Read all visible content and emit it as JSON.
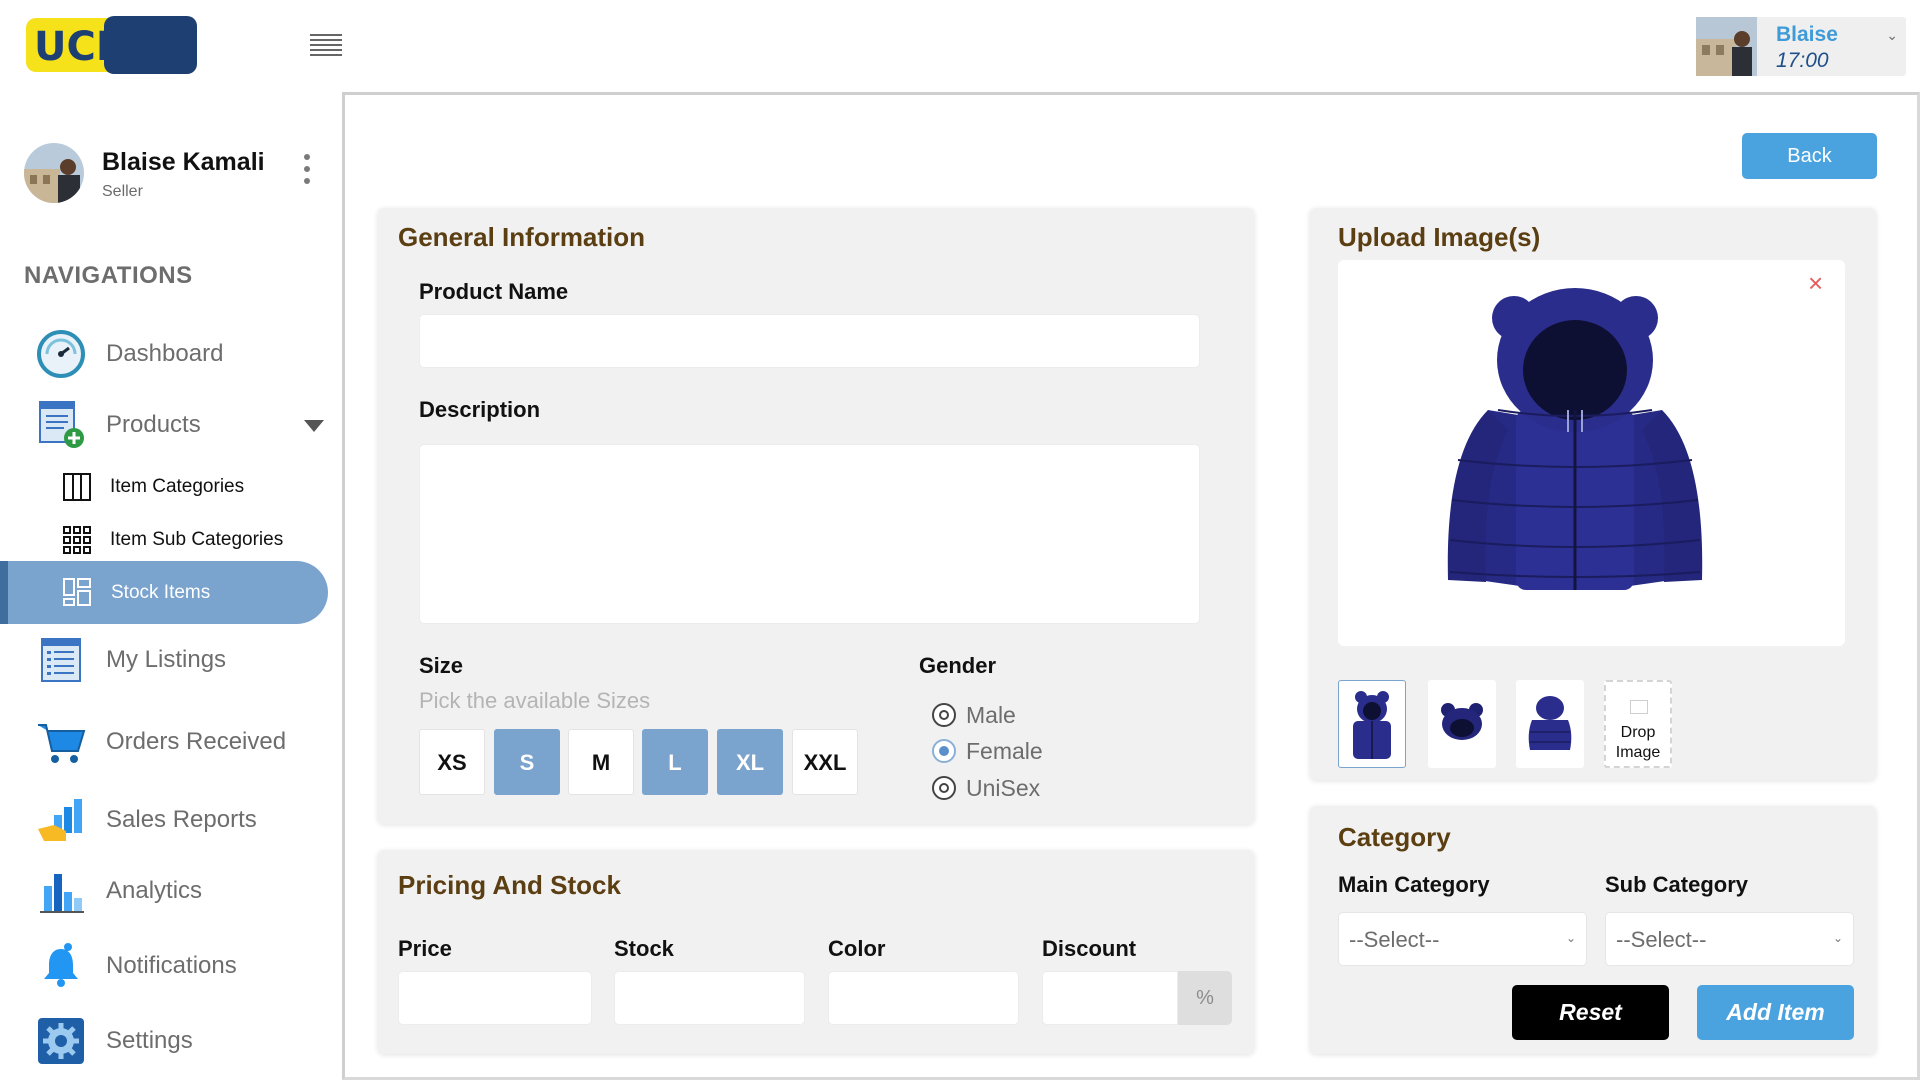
{
  "header": {
    "logo_text": "UCEP",
    "user": {
      "name": "Blaise",
      "time": "17:00"
    }
  },
  "sidebar": {
    "profile": {
      "name": "Blaise Kamali",
      "role": "Seller"
    },
    "heading": "NAVIGATIONS",
    "items": [
      {
        "label": "Dashboard",
        "icon": "dashboard-gauge-icon"
      },
      {
        "label": "Products",
        "icon": "products-list-add-icon"
      },
      {
        "label": "My Listings",
        "icon": "listings-icon"
      },
      {
        "label": "Orders Received",
        "icon": "shopping-cart-icon"
      },
      {
        "label": "Sales Reports",
        "icon": "sales-report-icon"
      },
      {
        "label": "Analytics",
        "icon": "bar-chart-icon"
      },
      {
        "label": "Notifications",
        "icon": "bell-icon"
      },
      {
        "label": "Settings",
        "icon": "gear-icon"
      }
    ],
    "sub_items": [
      {
        "label": "Item Categories",
        "icon": "columns-icon"
      },
      {
        "label": "Item Sub Categories",
        "icon": "grid-icon"
      },
      {
        "label": "Stock Items",
        "icon": "layout-icon",
        "active": true
      }
    ]
  },
  "actions": {
    "back": "Back",
    "reset": "Reset",
    "add_item": "Add Item"
  },
  "general": {
    "title": "General Information",
    "product_name_label": "Product Name",
    "product_name_value": "",
    "description_label": "Description",
    "description_value": "",
    "size_label": "Size",
    "size_hint": "Pick the available Sizes",
    "sizes": [
      {
        "label": "XS",
        "selected": false
      },
      {
        "label": "S",
        "selected": true
      },
      {
        "label": "M",
        "selected": false
      },
      {
        "label": "L",
        "selected": true
      },
      {
        "label": "XL",
        "selected": true
      },
      {
        "label": "XXL",
        "selected": false
      }
    ],
    "gender_label": "Gender",
    "genders": [
      {
        "label": "Male",
        "selected": false
      },
      {
        "label": "Female",
        "selected": true
      },
      {
        "label": "UniSex",
        "selected": false
      }
    ]
  },
  "pricing": {
    "title": "Pricing And Stock",
    "price_label": "Price",
    "stock_label": "Stock",
    "color_label": "Color",
    "discount_label": "Discount",
    "discount_suffix": "%"
  },
  "upload": {
    "title": "Upload Image(s)",
    "close_symbol": "×",
    "drop_label_1": "Drop",
    "drop_label_2": "Image"
  },
  "category": {
    "title": "Category",
    "main_label": "Main Category",
    "sub_label": "Sub Category",
    "main_value": "--Select--",
    "sub_value": "--Select--"
  },
  "colors": {
    "accent_blue": "#4aa3df",
    "selected_blue": "#7aa3ce",
    "panel_title": "#5b3e12",
    "jacket": "#2a2d8c"
  }
}
